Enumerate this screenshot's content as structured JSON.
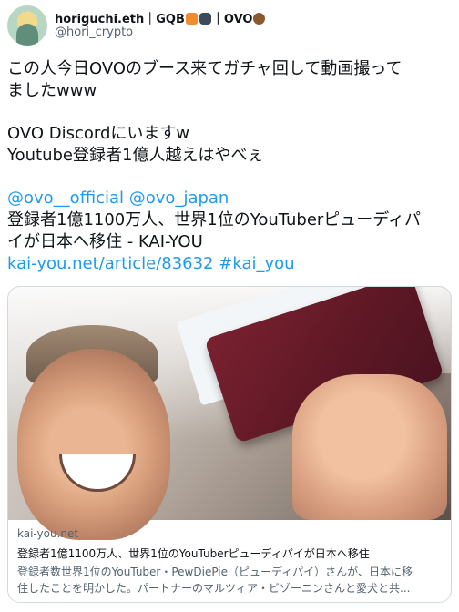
{
  "user": {
    "name": "horiguchi.eth｜GQB",
    "name_suffix": "｜OVO",
    "handle": "@hori_crypto"
  },
  "tweet": {
    "line1": "この人今日OVOのブース来てガチャ回して動画撮って",
    "line2": "ましたwww",
    "line3": "OVO Discordにいますw",
    "line4": "Youtube登録者1億人越えはやべぇ",
    "mention1": "@ovo__official",
    "mention2": "@ovo_japan",
    "line6": "登録者1億1100万人、世界1位のYouTuberピューディパ",
    "line7": "イが日本へ移住 - KAI-YOU",
    "link": "kai-you.net/article/83632",
    "hashtag": "#kai_you"
  },
  "card": {
    "domain": "kai-you.net",
    "title": "登録者1億1100万人、世界1位のYouTuberピューディパイが日本へ移住",
    "desc1": "登録者数世界1位のYouTuber・PewDiePie（ピューディパイ）さんが、日本に移",
    "desc2": "住したことを明かした。パートナーのマルツィア・ビゾーニンさんと愛犬と共..."
  },
  "icons": {
    "fox": "fox-emoji",
    "gamepad": "gamepad-emoji",
    "owl": "owl-emoji"
  }
}
